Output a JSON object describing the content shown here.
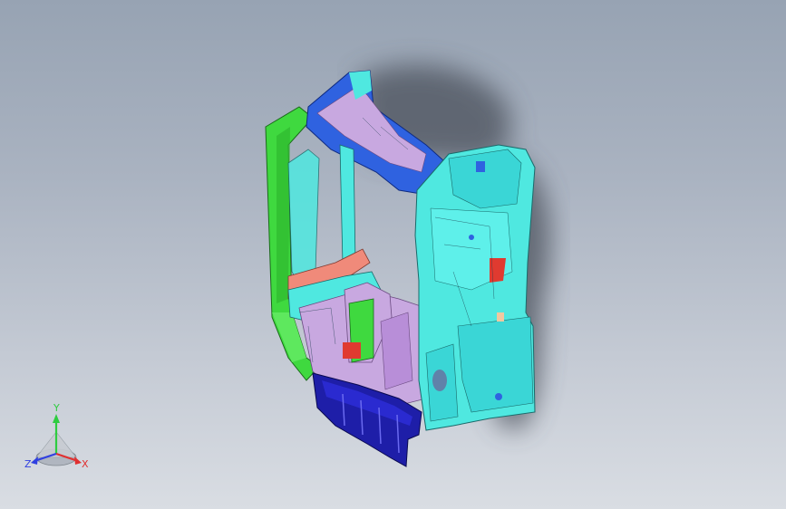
{
  "viewport": {
    "background_top": "#97a3b3",
    "background_bottom": "#d9dde3"
  },
  "model": {
    "name_icon": "sheet-metal-frame-assembly-icon",
    "colors": {
      "green": "#3fd93f",
      "cyan": "#4fe8e0",
      "lavender": "#c8a8e0",
      "blue": "#2f62e0",
      "navy": "#1e1ea8",
      "salmon": "#f08a7a",
      "red": "#e03a30",
      "shadow": "#4a4f5a"
    }
  },
  "triad": {
    "icon": "coordinate-axes-triad-icon",
    "y_label": "Y",
    "x_label": "X",
    "z_label": "Z",
    "y_color": "#2ecc40",
    "x_color": "#e03030",
    "z_color": "#3040e0"
  }
}
